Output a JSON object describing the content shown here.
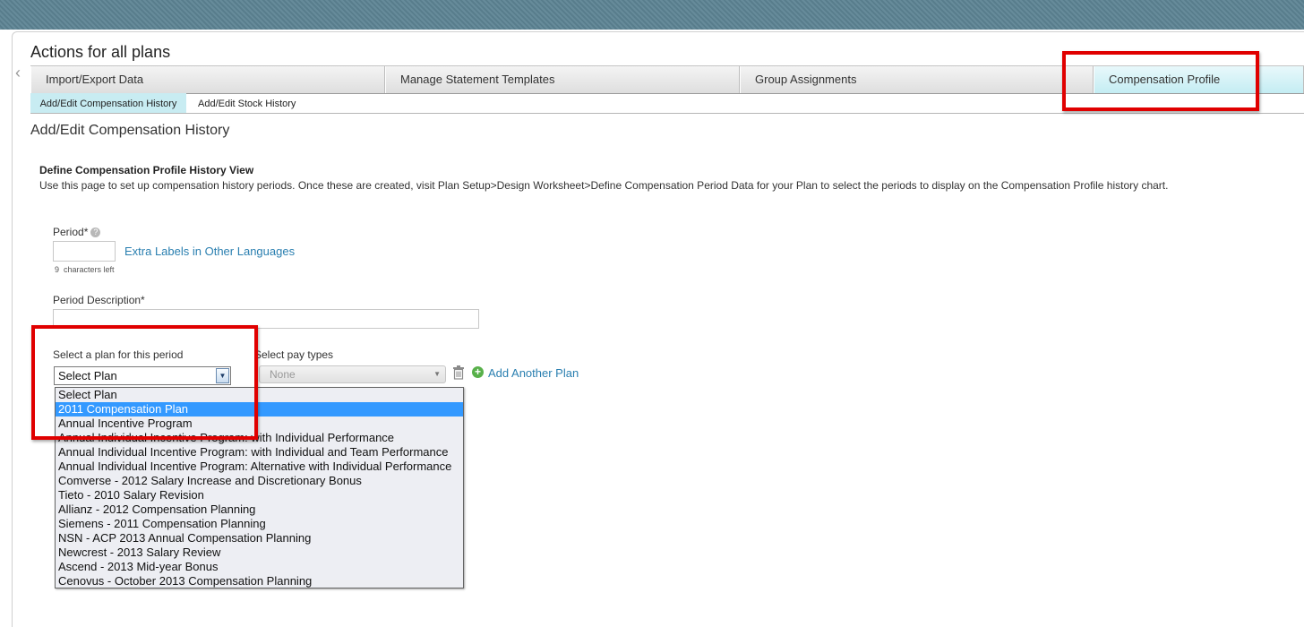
{
  "section_title": "Actions for all plans",
  "tabs": [
    {
      "label": "Import/Export Data"
    },
    {
      "label": "Manage Statement Templates"
    },
    {
      "label": "Group Assignments"
    },
    {
      "label": "Compensation Profile"
    }
  ],
  "subtabs": [
    {
      "label": "Add/Edit Compensation History"
    },
    {
      "label": "Add/Edit Stock History"
    }
  ],
  "page_heading": "Add/Edit Compensation History",
  "form": {
    "title": "Define Compensation Profile History View",
    "description": "Use this page to set up compensation history periods. Once these are created, visit Plan Setup>Design Worksheet>Define Compensation Period Data for your Plan to select the periods to display on the Compensation Profile history chart.",
    "period_label": "Period",
    "required_mark": "*",
    "help_glyph": "?",
    "period_value": "",
    "extra_labels_link": "Extra Labels in Other Languages",
    "chars_left_count": "9",
    "chars_left_text": "characters left",
    "period_description_label": "Period Description",
    "period_description_value": "",
    "plan_label": "Select a plan for this period",
    "plan_selected": "Select Plan",
    "pay_types_label": "Select pay types",
    "pay_types_selected": "None",
    "add_another_plan_link": "Add Another Plan",
    "add_glyph": "+"
  },
  "plan_options": [
    "Select Plan",
    "2011 Compensation Plan",
    "Annual Incentive Program",
    "Annual Individual Incentive Program: with Individual Performance",
    "Annual Individual Incentive Program: with Individual and Team Performance",
    "Annual Individual Incentive Program: Alternative with Individual Performance",
    "Comverse - 2012 Salary Increase and Discretionary Bonus",
    "Tieto - 2010 Salary Revision",
    "Allianz - 2012 Compensation Planning",
    "Siemens - 2011 Compensation Planning",
    "NSN - ACP 2013 Annual Compensation Planning",
    "Newcrest - 2013 Salary Review",
    "Ascend - 2013 Mid-year Bonus",
    "Cenovus - October 2013 Compensation Planning"
  ],
  "highlighted_option_index": 1,
  "colors": {
    "topbar": "#5d8494",
    "active_tab": "#c4edf3",
    "link": "#2a7fb0",
    "highlight": "#3399ff",
    "annotation_red": "#e00000"
  }
}
